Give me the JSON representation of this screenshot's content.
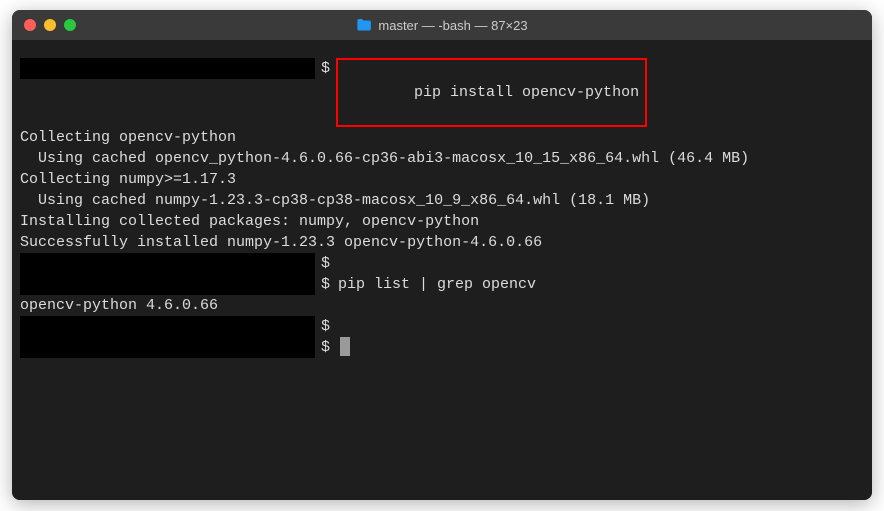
{
  "titlebar": {
    "title": "master — -bash — 87×23"
  },
  "prompt": "$",
  "lines": {
    "cmd1": "pip install opencv-python",
    "out1": "Collecting opencv-python",
    "out2": "  Using cached opencv_python-4.6.0.66-cp36-abi3-macosx_10_15_x86_64.whl (46.4 MB)",
    "out3": "Collecting numpy>=1.17.3",
    "out4": "  Using cached numpy-1.23.3-cp38-cp38-macosx_10_9_x86_64.whl (18.1 MB)",
    "out5": "Installing collected packages: numpy, opencv-python",
    "out6": "Successfully installed numpy-1.23.3 opencv-python-4.6.0.66",
    "cmd2": "pip list | grep opencv",
    "out7": "opencv-python 4.6.0.66"
  }
}
